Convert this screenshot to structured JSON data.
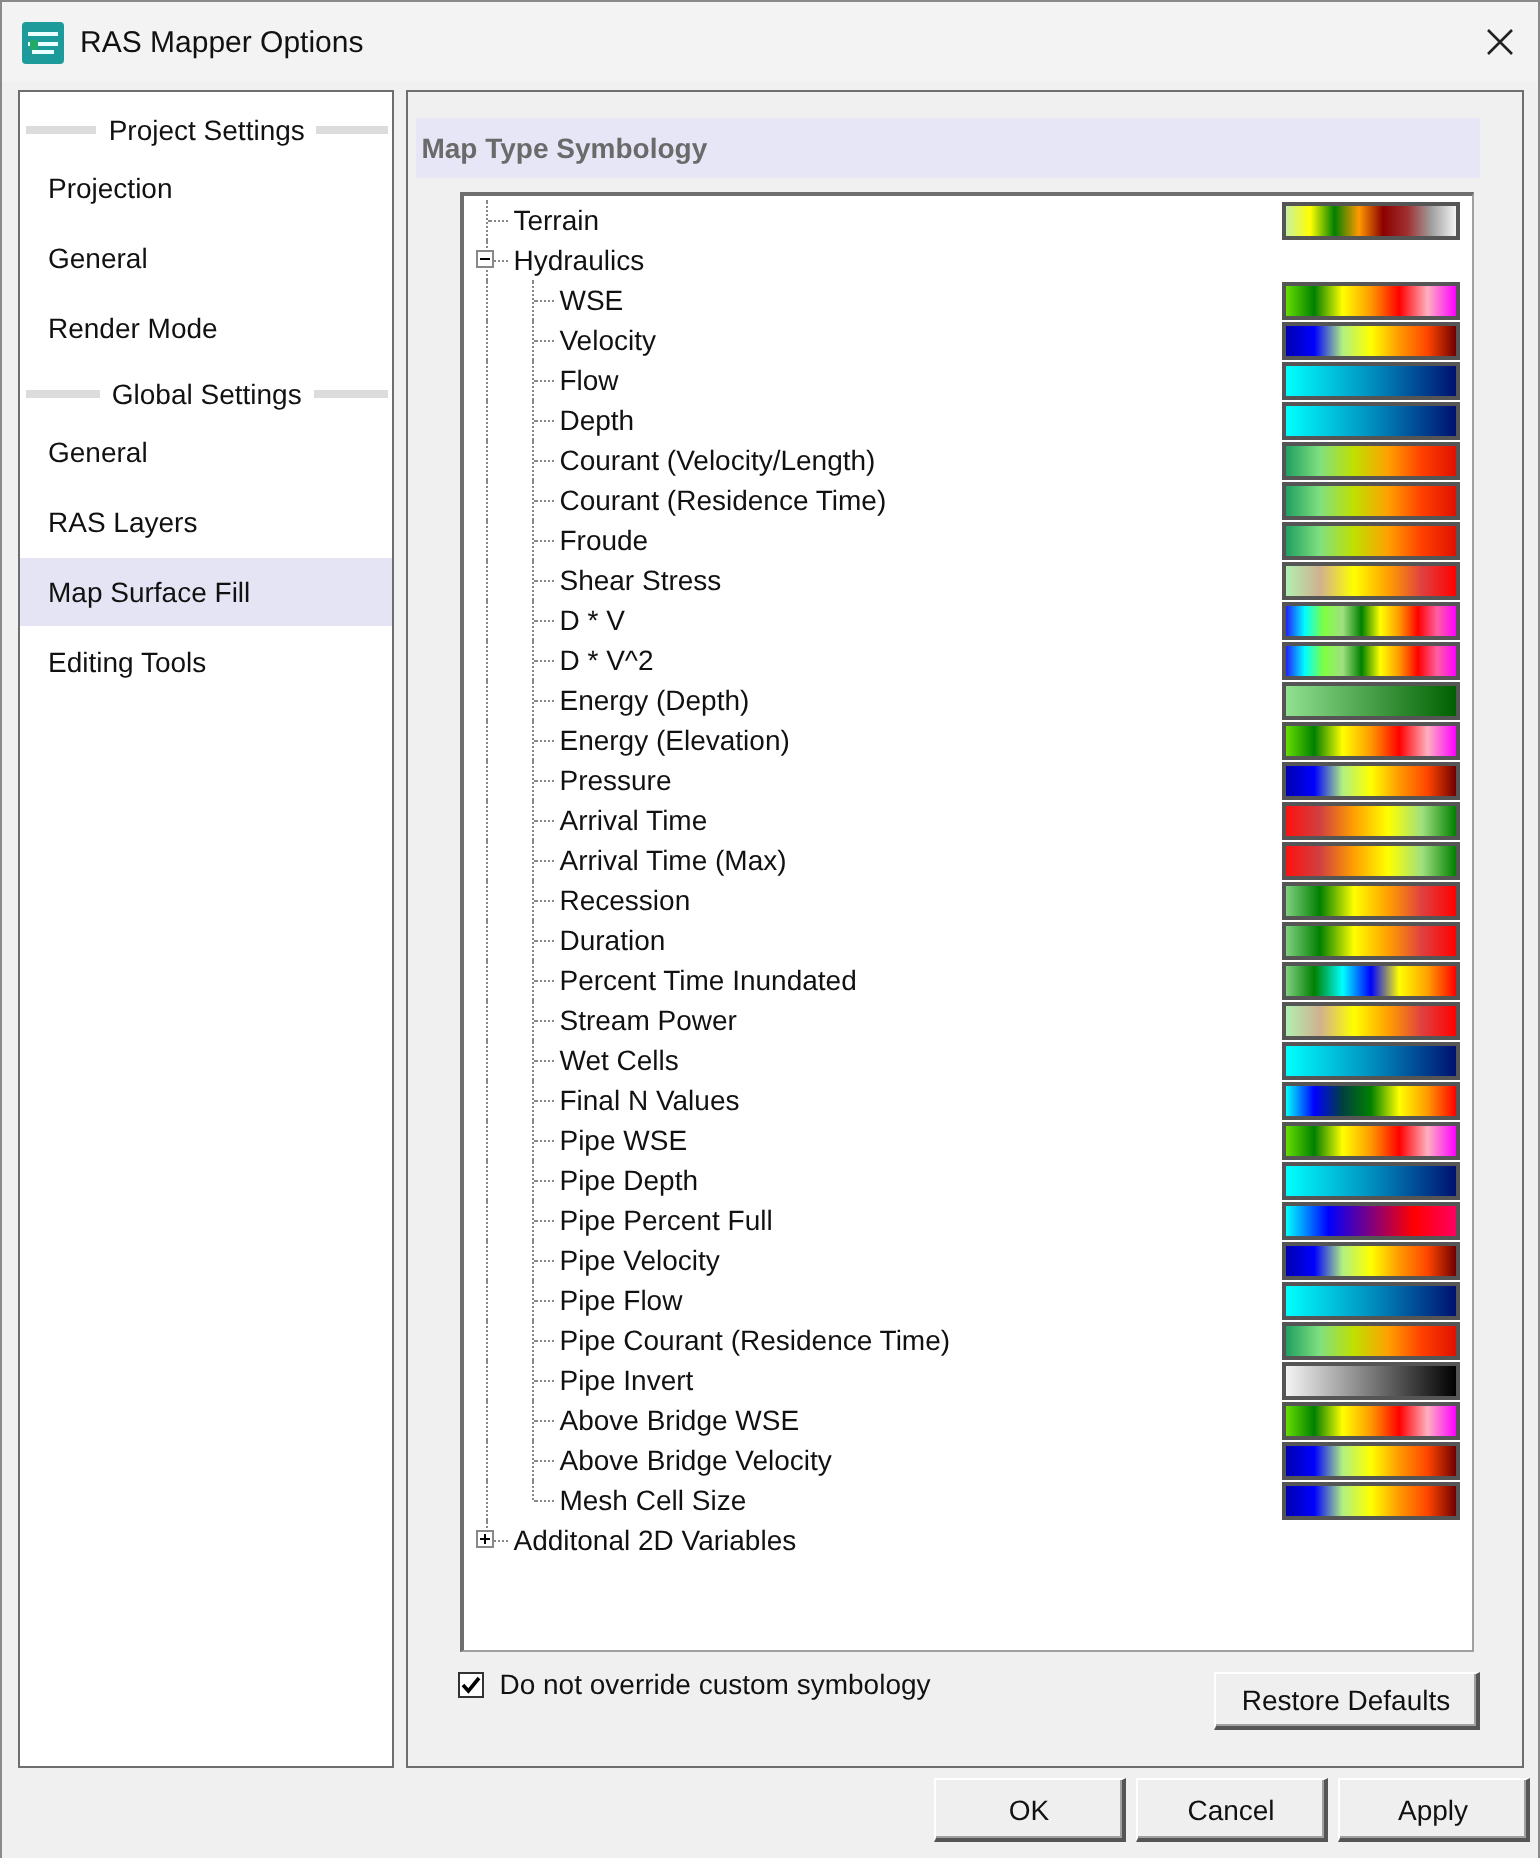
{
  "window": {
    "title": "RAS Mapper Options"
  },
  "sidebar": {
    "groups": [
      {
        "title": "Project Settings",
        "items": [
          {
            "label": "Projection",
            "selected": false
          },
          {
            "label": "General",
            "selected": false
          },
          {
            "label": "Render Mode",
            "selected": false
          }
        ]
      },
      {
        "title": "Global Settings",
        "items": [
          {
            "label": "General",
            "selected": false
          },
          {
            "label": "RAS Layers",
            "selected": false
          },
          {
            "label": "Map Surface Fill",
            "selected": true
          },
          {
            "label": "Editing Tools",
            "selected": false
          }
        ]
      }
    ]
  },
  "panel": {
    "title": "Map Type Symbology",
    "tree": [
      {
        "label": "Terrain",
        "kind": "terrain"
      },
      {
        "label": "Hydraulics",
        "expanded": true,
        "children": [
          {
            "label": "WSE",
            "kind": "elevation"
          },
          {
            "label": "Velocity",
            "kind": "velocity"
          },
          {
            "label": "Flow",
            "kind": "depth"
          },
          {
            "label": "Depth",
            "kind": "depth"
          },
          {
            "label": "Courant (Velocity/Length)",
            "kind": "courant"
          },
          {
            "label": "Courant (Residence Time)",
            "kind": "courant"
          },
          {
            "label": "Froude",
            "kind": "courant"
          },
          {
            "label": "Shear Stress",
            "kind": "shear"
          },
          {
            "label": "D * V",
            "kind": "hazard"
          },
          {
            "label": "D * V^2",
            "kind": "hazard"
          },
          {
            "label": "Energy (Depth)",
            "kind": "greens"
          },
          {
            "label": "Energy (Elevation)",
            "kind": "elevation"
          },
          {
            "label": "Pressure",
            "kind": "velocity"
          },
          {
            "label": "Arrival Time",
            "kind": "arrival"
          },
          {
            "label": "Arrival Time (Max)",
            "kind": "arrival"
          },
          {
            "label": "Recession",
            "kind": "duration"
          },
          {
            "label": "Duration",
            "kind": "duration"
          },
          {
            "label": "Percent Time Inundated",
            "kind": "inundation"
          },
          {
            "label": "Stream Power",
            "kind": "shear"
          },
          {
            "label": "Wet Cells",
            "kind": "depth"
          },
          {
            "label": "Final N Values",
            "kind": "roughness"
          },
          {
            "label": "Pipe WSE",
            "kind": "elevation"
          },
          {
            "label": "Pipe Depth",
            "kind": "depth"
          },
          {
            "label": "Pipe Percent Full",
            "kind": "percent"
          },
          {
            "label": "Pipe Velocity",
            "kind": "velocity"
          },
          {
            "label": "Pipe Flow",
            "kind": "depth"
          },
          {
            "label": "Pipe Courant (Residence Time)",
            "kind": "courant"
          },
          {
            "label": "Pipe Invert",
            "kind": "grays"
          },
          {
            "label": "Above Bridge WSE",
            "kind": "elevation"
          },
          {
            "label": "Above Bridge Velocity",
            "kind": "velocity"
          },
          {
            "label": "Mesh Cell Size",
            "kind": "velocity"
          }
        ]
      },
      {
        "label": "Additonal 2D Variables",
        "expanded": false
      }
    ],
    "override_checkbox": {
      "label": "Do not override custom symbology",
      "checked": true
    },
    "restore_button": "Restore Defaults"
  },
  "buttons": [
    "OK",
    "Cancel",
    "Apply"
  ]
}
